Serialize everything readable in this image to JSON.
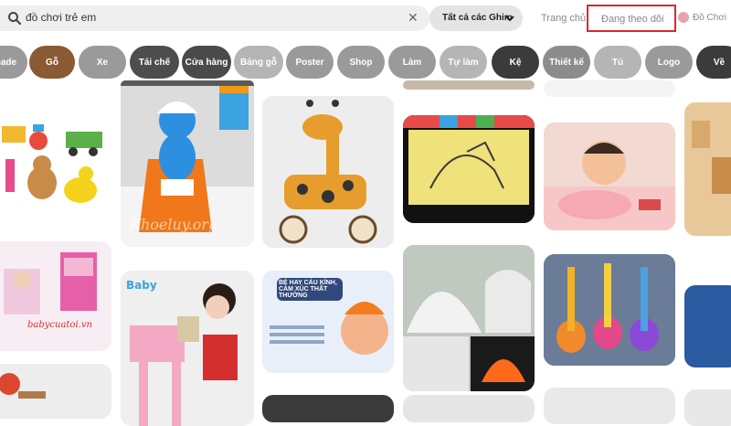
{
  "header": {
    "search_value": "đồ chơi trẻ em",
    "filter_label": "Tất cả các Ghim",
    "nav_home": "Trang chủ",
    "nav_following": "Đang theo dõi",
    "nav_user": "Đồ Chơi"
  },
  "chips": [
    {
      "label": "made",
      "color": "#9a9a9a"
    },
    {
      "label": "Gỗ",
      "color": "#8a5a35"
    },
    {
      "label": "Xe",
      "color": "#9a9a9a"
    },
    {
      "label": "Tái chế",
      "color": "#4d4d4d"
    },
    {
      "label": "Cửa hàng",
      "color": "#4a4a4a"
    },
    {
      "label": "Bảng gỗ",
      "color": "#b5b5b5"
    },
    {
      "label": "Poster",
      "color": "#9a9a9a"
    },
    {
      "label": "Shop",
      "color": "#9a9a9a"
    },
    {
      "label": "Làm",
      "color": "#9a9a9a"
    },
    {
      "label": "Tự làm",
      "color": "#b5b5b5"
    },
    {
      "label": "Kệ",
      "color": "#3b3b3b"
    },
    {
      "label": "Thiết kế",
      "color": "#8c8c8c"
    },
    {
      "label": "Tủ",
      "color": "#b5b5b5"
    },
    {
      "label": "Logo",
      "color": "#9a9a9a"
    },
    {
      "label": "Về",
      "color": "#3b3b3b"
    }
  ],
  "pins": {
    "wm_khoeluy": "Khoeluy.org",
    "caption_babycuatoi": "babycuatoi.vn",
    "card_headline": "BÉ HAY CÁU KỈNH, CẢM XÚC THẤT THƯỜNG"
  },
  "colors": {
    "highlight_border": "#e0262a"
  }
}
